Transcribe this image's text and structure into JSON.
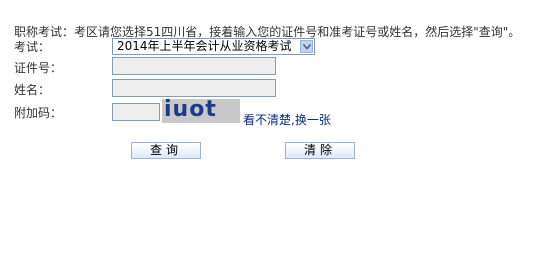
{
  "notice": "职称考试：考区请您选择51四川省，接着输入您的证件号和准考证号或姓名，然后选择\"查询\"。",
  "form": {
    "exam_label": "考试：",
    "exam_selected": "2014年上半年会计从业资格考试",
    "id_label": "证件号：",
    "id_value": "",
    "name_label": "姓名：",
    "name_value": "",
    "code_label": "附加码：",
    "code_value": "",
    "captcha_text": "iuot",
    "refresh_link": "看不清楚,换一张"
  },
  "buttons": {
    "query_label": "查询",
    "clear_label": "清除"
  },
  "colors": {
    "captcha_bg": "#c8c8c8",
    "captcha_text": "#1b3a8c",
    "link": "#0a2a8a",
    "input_bg": "#eeeeee",
    "input_border": "#7f9db9"
  }
}
